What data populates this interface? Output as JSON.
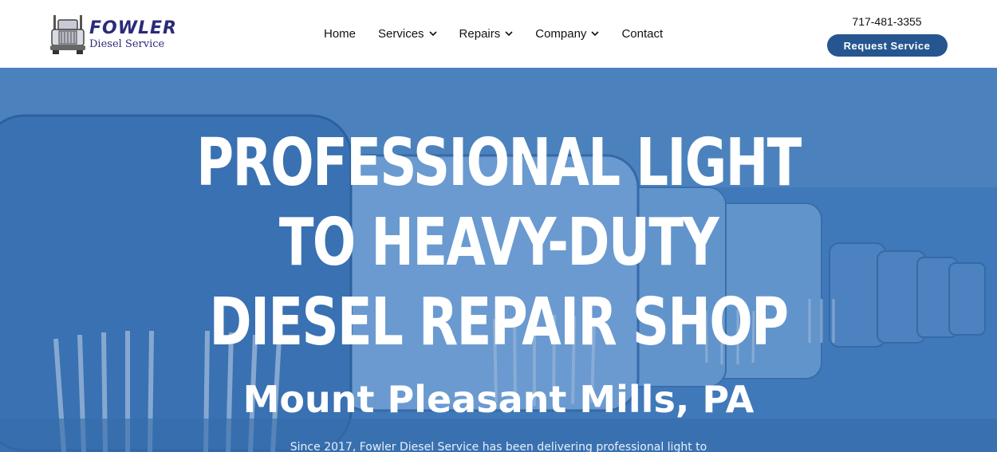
{
  "brand": {
    "name": "FOWLER",
    "subtitle": "Diesel Service"
  },
  "nav": {
    "items": [
      {
        "label": "Home",
        "has_dropdown": false
      },
      {
        "label": "Services",
        "has_dropdown": true
      },
      {
        "label": "Repairs",
        "has_dropdown": true
      },
      {
        "label": "Company",
        "has_dropdown": true
      },
      {
        "label": "Contact",
        "has_dropdown": false
      }
    ]
  },
  "contact": {
    "phone": "717-481-3355",
    "cta_label": "Request Service"
  },
  "hero": {
    "title": "Professional Light to Heavy-Duty Diesel Repair Shop",
    "location": "Mount Pleasant Mills, PA",
    "description": "Since 2017, Fowler Diesel Service has been delivering professional light to"
  },
  "colors": {
    "brand_navy": "#2b2b7a",
    "button_blue": "#25568f",
    "hero_blue": "#3d78b8",
    "white": "#ffffff"
  }
}
